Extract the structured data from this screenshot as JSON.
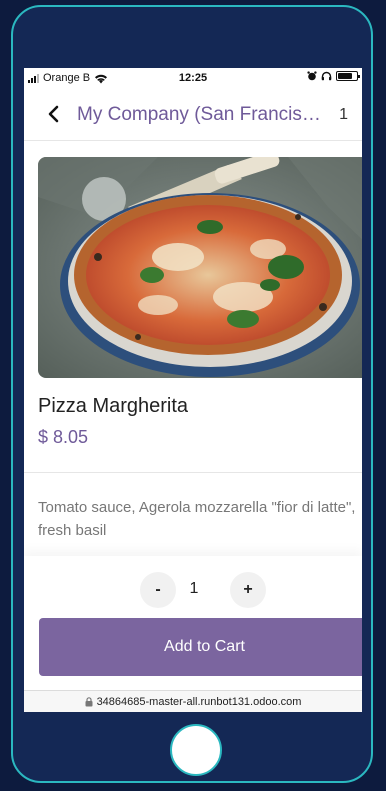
{
  "status_bar": {
    "carrier": "Orange B",
    "time": "12:25"
  },
  "header": {
    "title": "My Company (San Francisco)",
    "cart_count": "1"
  },
  "product": {
    "name": "Pizza Margherita",
    "price": "$ 8.05",
    "description": "Tomato sauce, Agerola mozzarella \"fior di latte\", fresh basil"
  },
  "quantity": {
    "decrement_label": "-",
    "value": "1",
    "increment_label": "+"
  },
  "actions": {
    "add_to_cart_label": "Add to Cart"
  },
  "browser": {
    "url": "34864685-master-all.runbot131.odoo.com"
  },
  "colors": {
    "accent": "#7b659f",
    "title": "#6f5a99",
    "frame_border": "#2bb8c0",
    "background": "#0d1b3e"
  },
  "status": {
    "battery_level_percent": 80
  }
}
